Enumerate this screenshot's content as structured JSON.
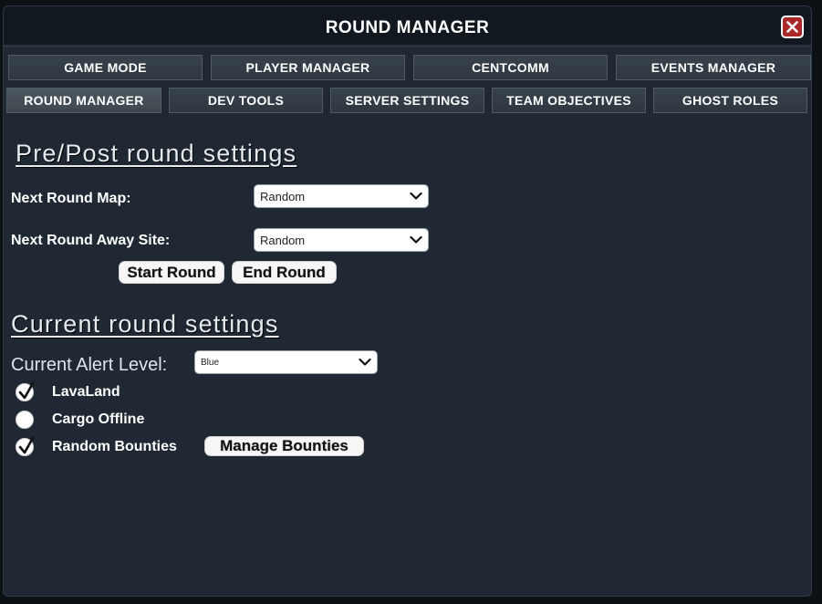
{
  "window": {
    "title": "ROUND MANAGER"
  },
  "tabs": {
    "row1": [
      "GAME MODE",
      "PLAYER MANAGER",
      "CENTCOMM",
      "EVENTS MANAGER"
    ],
    "row2": [
      "ROUND MANAGER",
      "DEV TOOLS",
      "SERVER SETTINGS",
      "TEAM OBJECTIVES",
      "GHOST ROLES"
    ],
    "active": "ROUND MANAGER"
  },
  "pre_post": {
    "heading": "Pre/Post round settings",
    "next_map_label": "Next Round Map:",
    "next_map_value": "Random",
    "away_site_label": "Next Round Away Site:",
    "away_site_value": "Random",
    "start_round_label": "Start Round",
    "end_round_label": "End Round"
  },
  "current": {
    "heading": "Current round settings",
    "alert_label": "Current Alert Level:",
    "alert_value": "Blue",
    "options": [
      {
        "label": "LavaLand",
        "checked": true
      },
      {
        "label": "Cargo Offline",
        "checked": false
      },
      {
        "label": "Random Bounties",
        "checked": true
      }
    ],
    "manage_bounties_label": "Manage Bounties"
  },
  "colors": {
    "window_bg": "#1f2833",
    "titlebar_bg": "#111820",
    "close_red": "#a92828",
    "tab_bg": "#38424c"
  },
  "icons": {
    "close": "close-icon",
    "dropdown": "chevron-down-icon",
    "check": "checkmark-icon"
  }
}
